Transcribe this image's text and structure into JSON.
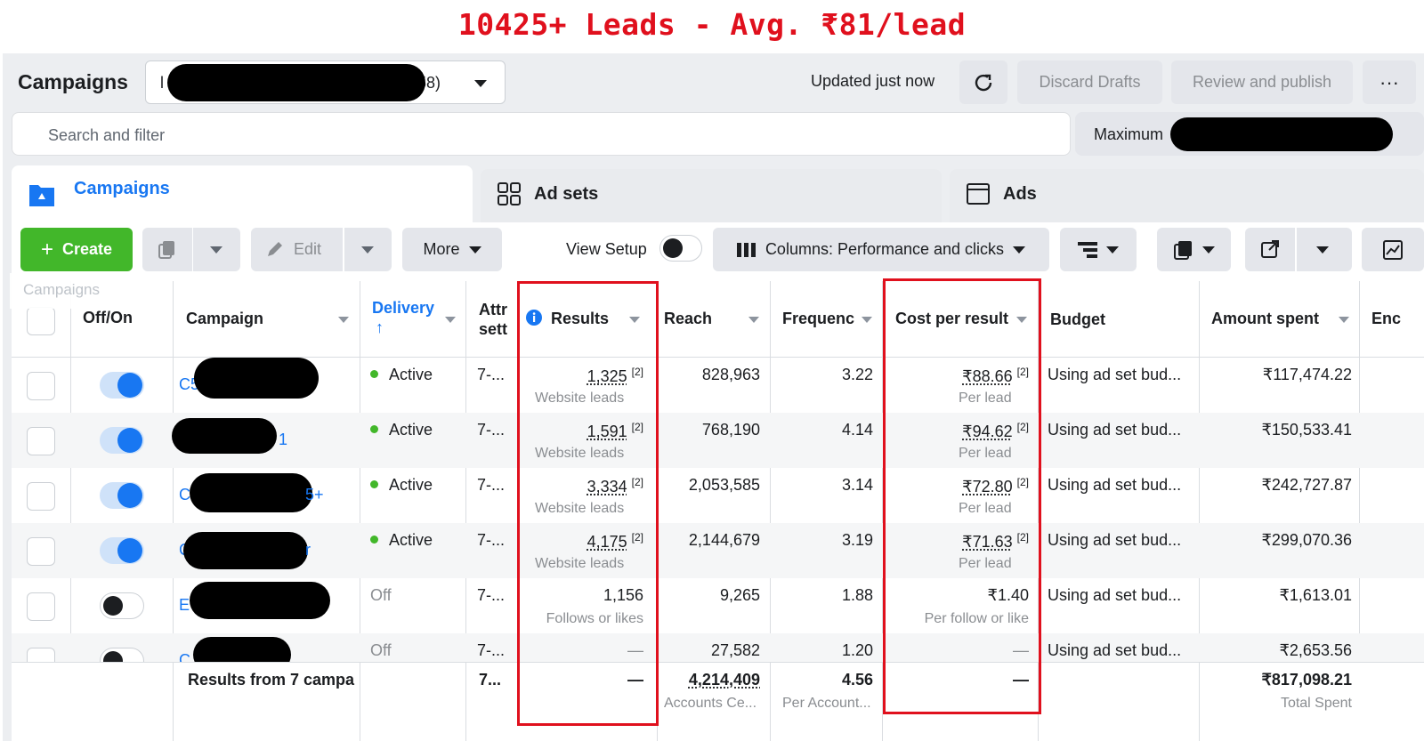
{
  "banner": "10425+ Leads - Avg. ₹81/lead",
  "header": {
    "title": "Campaigns",
    "account_prefix": "l",
    "account_suffix": "58)",
    "updated": "Updated just now",
    "discard": "Discard Drafts",
    "review": "Review and publish",
    "more": "···"
  },
  "search": {
    "placeholder": "Search and filter",
    "max_label": "Maximum"
  },
  "tabs": [
    {
      "label": "Campaigns"
    },
    {
      "label": "Ad sets"
    },
    {
      "label": "Ads"
    }
  ],
  "toolbar": {
    "create": "Create",
    "edit": "Edit",
    "more": "More",
    "view_setup": "View Setup",
    "columns": "Columns: Performance and clicks",
    "tooltip": "Campaigns"
  },
  "columns": {
    "onoff": "Off/On",
    "campaign": "Campaign",
    "delivery": "Delivery",
    "delivery_arrow": "↑",
    "attr": "Attr",
    "attr2": "sett",
    "results": "Results",
    "reach": "Reach",
    "frequency": "Frequenc",
    "cost": "Cost per result",
    "budget": "Budget",
    "amount": "Amount spent",
    "ends": "Enc"
  },
  "rows": [
    {
      "on": true,
      "name_prefix": "C5",
      "name_suffix": "",
      "delivery": "Active",
      "attr": "7-...",
      "results": "1,325",
      "results_sup": "[2]",
      "results_type": "Website leads",
      "reach": "828,963",
      "frequency": "3.22",
      "cost": "₹88.66",
      "cost_sup": "[2]",
      "cost_type": "Per lead",
      "budget": "Using ad set bud...",
      "amount": "₹117,474.22"
    },
    {
      "on": true,
      "name_prefix": "",
      "name_suffix": "1",
      "delivery": "Active",
      "attr": "7-...",
      "results": "1,591",
      "results_sup": "[2]",
      "results_type": "Website leads",
      "reach": "768,190",
      "frequency": "4.14",
      "cost": "₹94.62",
      "cost_sup": "[2]",
      "cost_type": "Per lead",
      "budget": "Using ad set bud...",
      "amount": "₹150,533.41"
    },
    {
      "on": true,
      "name_prefix": "C",
      "name_suffix": "5+",
      "delivery": "Active",
      "attr": "7-...",
      "results": "3,334",
      "results_sup": "[2]",
      "results_type": "Website leads",
      "reach": "2,053,585",
      "frequency": "3.14",
      "cost": "₹72.80",
      "cost_sup": "[2]",
      "cost_type": "Per lead",
      "budget": "Using ad set bud...",
      "amount": "₹242,727.87"
    },
    {
      "on": true,
      "name_prefix": "C",
      "name_suffix": "r",
      "delivery": "Active",
      "attr": "7-...",
      "results": "4,175",
      "results_sup": "[2]",
      "results_type": "Website leads",
      "reach": "2,144,679",
      "frequency": "3.19",
      "cost": "₹71.63",
      "cost_sup": "[2]",
      "cost_type": "Per lead",
      "budget": "Using ad set bud...",
      "amount": "₹299,070.36"
    },
    {
      "on": false,
      "name_prefix": "E",
      "name_suffix": "",
      "delivery": "Off",
      "attr": "7-...",
      "results": "1,156",
      "results_sup": "",
      "results_type": "Follows or likes",
      "reach": "9,265",
      "frequency": "1.88",
      "cost": "₹1.40",
      "cost_sup": "",
      "cost_type": "Per follow or like",
      "budget": "Using ad set bud...",
      "amount": "₹1,613.01"
    },
    {
      "on": false,
      "name_prefix": "C",
      "name_suffix": "",
      "delivery": "Off",
      "attr": "7-...",
      "results": "—",
      "results_sup": "",
      "results_type": "",
      "reach": "27,582",
      "frequency": "1.20",
      "cost": "—",
      "cost_sup": "",
      "cost_type": "",
      "budget": "Using ad set bud...",
      "amount": "₹2,653.56"
    }
  ],
  "footer": {
    "label": "Results from 7 campa",
    "attr": "7...",
    "results": "—",
    "reach": "4,214,409",
    "reach_sub": "Accounts Ce...",
    "frequency": "4.56",
    "frequency_sub": "Per Account...",
    "cost": "—",
    "amount": "₹817,098.21",
    "amount_sub": "Total Spent"
  },
  "colors": {
    "accent": "#1877f2",
    "create": "#42b72a",
    "highlight": "#e0101d",
    "active_dot": "#42b72a"
  }
}
